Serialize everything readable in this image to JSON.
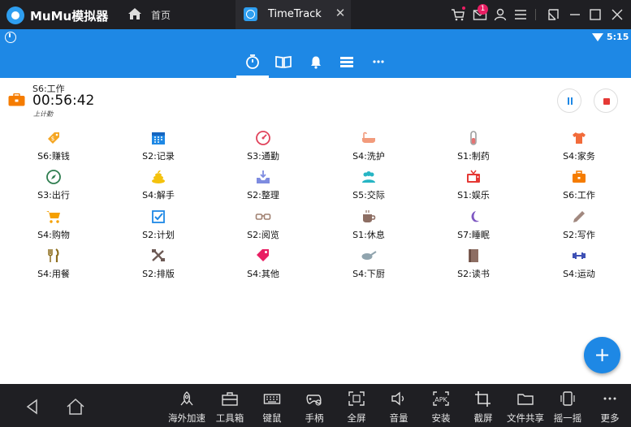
{
  "window": {
    "app_name": "MuMu模拟器",
    "home_tab": "首页",
    "active_tab": "TimeTrack",
    "notification_count": "1"
  },
  "status_bar": {
    "time": "5:15"
  },
  "current": {
    "name": "S6:工作",
    "elapsed": "00:56:42",
    "hint": "上计勤"
  },
  "activities": [
    {
      "label": "S6:赚钱",
      "icon": "money-tag-icon",
      "color": "#f5a623"
    },
    {
      "label": "S2:记录",
      "icon": "calendar-icon",
      "color": "#1e88e5"
    },
    {
      "label": "S3:通勤",
      "icon": "speedometer-icon",
      "color": "#e0435b"
    },
    {
      "label": "S4:洗护",
      "icon": "bathtub-icon",
      "color": "#f29b7c"
    },
    {
      "label": "S1:制药",
      "icon": "test-tube-icon",
      "color": "#9e9e9e"
    },
    {
      "label": "S4:家务",
      "icon": "tshirt-icon",
      "color": "#f26b3a"
    },
    {
      "label": "S3:出行",
      "icon": "compass-icon",
      "color": "#2e7d4f"
    },
    {
      "label": "S4:解手",
      "icon": "poop-icon",
      "color": "#f4c20d"
    },
    {
      "label": "S2:整理",
      "icon": "inbox-download-icon",
      "color": "#7e8ce0"
    },
    {
      "label": "S5:交际",
      "icon": "people-icon",
      "color": "#26b5c4"
    },
    {
      "label": "S1:娱乐",
      "icon": "tv-icon",
      "color": "#e53935"
    },
    {
      "label": "S6:工作",
      "icon": "briefcase-icon",
      "color": "#f57c00"
    },
    {
      "label": "S4:购物",
      "icon": "cart-icon",
      "color": "#f5a000"
    },
    {
      "label": "S2:计划",
      "icon": "checkbox-icon",
      "color": "#1e88e5"
    },
    {
      "label": "S2:阅览",
      "icon": "glasses-icon",
      "color": "#a08070"
    },
    {
      "label": "S1:休息",
      "icon": "coffee-cup-icon",
      "color": "#8d6e63"
    },
    {
      "label": "S7:睡眠",
      "icon": "moon-icon",
      "color": "#7e57c2"
    },
    {
      "label": "S2:写作",
      "icon": "pencil-icon",
      "color": "#a1887f"
    },
    {
      "label": "S4:用餐",
      "icon": "fork-knife-icon",
      "color": "#8d6e1e"
    },
    {
      "label": "S2:排版",
      "icon": "tools-icon",
      "color": "#6d5a55"
    },
    {
      "label": "S4:其他",
      "icon": "tag-icon",
      "color": "#e91e63"
    },
    {
      "label": "S4:下厨",
      "icon": "frying-pan-icon",
      "color": "#90a4ae"
    },
    {
      "label": "S2:读书",
      "icon": "book-icon",
      "color": "#8d6e63"
    },
    {
      "label": "S4:运动",
      "icon": "dumbbell-icon",
      "color": "#3f51b5"
    }
  ],
  "dock": {
    "tools": [
      "海外加速",
      "工具箱",
      "键鼠",
      "手柄",
      "全屏",
      "音量",
      "安装",
      "截屏",
      "文件共享",
      "摇一摇",
      "更多"
    ],
    "apk_text": "APK"
  },
  "fab_label": "+"
}
